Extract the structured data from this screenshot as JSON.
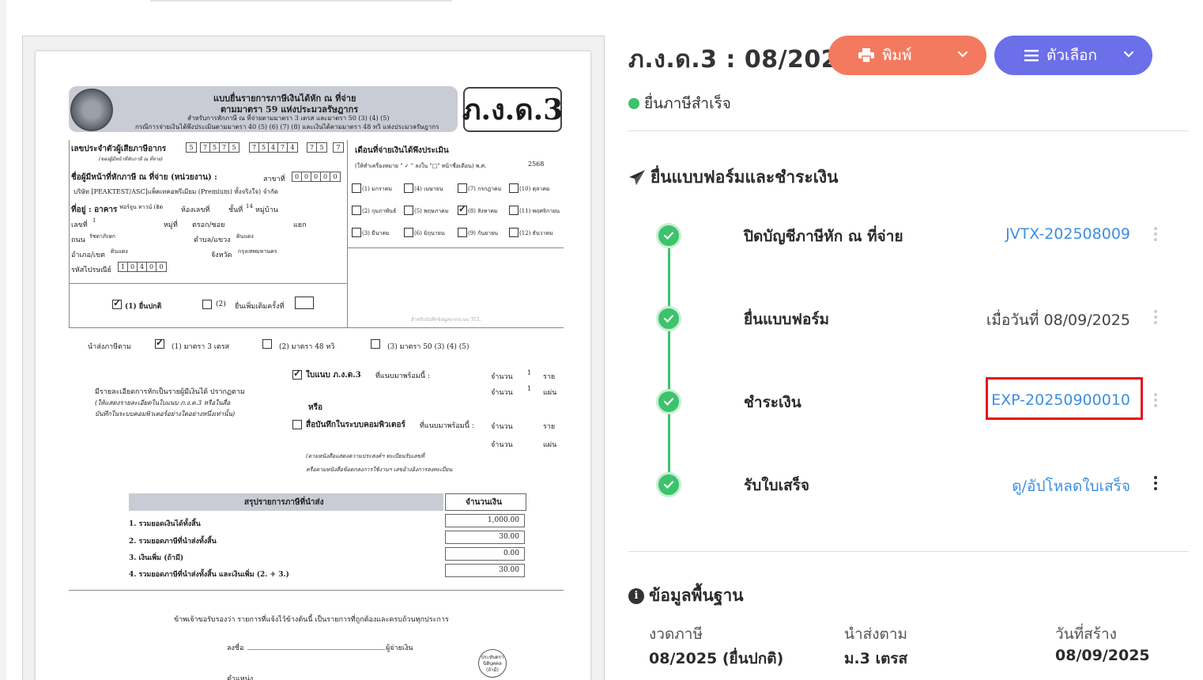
{
  "doc": {
    "form_badge": "ภ.ง.ด.3",
    "header_line1": "แบบยื่นรายการภาษีเงินได้หัก ณ ที่จ่าย",
    "header_line2": "ตามมาตรา 59 แห่งประมวลรัษฎากร",
    "header_line3": "สำหรับการหักภาษี ณ ที่จ่ายตามมาตรา 3 เตรส และมาตรา 50 (3) (4) (5)",
    "header_line4": "กรณีการจ่ายเงินได้พึงประเมินตามมาตรา 40 (5) (6) (7) (8) และเงินได้ตามมาตรา 48 ทวิ แห่งประมวลรัษฎากร",
    "taxid_label": "เลขประจำตัวผู้เสียภาษีอากร",
    "taxid_sub": "(ของผู้มีหน้าที่หักภาษี ณ ที่จ่าย)",
    "taxid_digits": [
      "5",
      "7",
      "5",
      "7",
      "5",
      "7",
      "5",
      "4",
      "7",
      "4",
      "7",
      "5",
      "7"
    ],
    "payer_label": "ชื่อผู้มีหน้าที่หักภาษี ณ ที่จ่าย (หน่วยงาน) :",
    "branch_label": "สาขาที่",
    "branch_digits": [
      "0",
      "0",
      "0",
      "0",
      "0"
    ],
    "payer_name": "บริษัท [PEAKTEST/ASC]แพ็คเทคอพรีเมียม (Premium) ทั้งจริงใจ) จำกัด",
    "addr_label": "ที่อยู่ : อาคาร",
    "addr_building": "ฟอร์จูน ทาวน์ (ฮิต",
    "addr_room": "ห้องเลขที่",
    "addr_floor": "ชั้นที่",
    "addr_floor_val": "14",
    "addr_village": "หมู่บ้าน",
    "addr_no": "เลขที่",
    "addr_no_val": "1",
    "addr_moo": "หมู่ที่",
    "addr_soi": "ตรอก/ซอย",
    "addr_yaek": "แยก",
    "addr_road": "ถนน",
    "addr_road_val": "รัชดาภิเษก",
    "addr_tambon": "ตำบล/แขวง",
    "addr_tambon_val": "ดินแดง",
    "addr_amphoe": "อำเภอ/เขต",
    "addr_amphoe_val": "ดินแดง",
    "addr_province": "จังหวัด",
    "addr_province_val": "กรุงเทพมหานคร",
    "postcode_label": "รหัสไปรษณีย์",
    "postcode_digits": [
      "1",
      "0",
      "4",
      "0",
      "0"
    ],
    "month_label": "เดือนที่จ่ายเงินได้พึงประเมิน",
    "month_hint": "(ให้ทำเครื่องหมาย \" ✓ \" ลงใน \"□\" หน้าชื่อเดือน) พ.ศ.",
    "year": "2568",
    "months": [
      "(1) มกราคม",
      "(4) เมษายน",
      "(7) กรกฎาคม",
      "(10) ตุลาคม",
      "(2) กุมภาพันธ์",
      "(5) พฤษภาคม",
      "(8) สิงหาคม",
      "(11) พฤศจิกายน",
      "(3) มีนาคม",
      "(6) มิถุนายน",
      "(9) กันยายน",
      "(12) ธันวาคม"
    ],
    "filing_normal": "(1) ยื่นปกติ",
    "filing_extra_num": "(2)",
    "filing_extra": "ยื่นเพิ่มเติมครั้งที่",
    "tcl_note": "สำหรับบันทึกข้อมูลจากระบบ TCL",
    "submit_label": "นำส่งภาษีตาม",
    "submit_opt1": "(1) มาตรา 3 เตรส",
    "submit_opt2": "(2) มาตรา 48 ทวิ",
    "submit_opt3": "(3) มาตรา 50 (3) (4) (5)",
    "attach_label": "ใบแนบ ภ.ง.ด.3",
    "attach_tail": "ที่แนบมาพร้อมนี้ :",
    "count_label": "จำนวน",
    "count_val1": "1",
    "count_unit1": "ราย",
    "count_val2": "1",
    "count_unit2": "แผ่น",
    "detail_l1": "มีรายละเอียดการหักเป็นรายผู้มีเงินได้ ปรากฏตาม",
    "detail_l2": "(ให้แสดงรายละเอียดในใบแนบ ภ.ง.ด.3 หรือในสื่อ",
    "detail_l3": "บันทึกในระบบคอมพิวเตอร์อย่างใดอย่างหนึ่งเท่านั้น)",
    "or_label": "หรือ",
    "media_label": "สื่อบันทึกในระบบคอมพิวเตอร์",
    "media_tail": "ที่แนบมาพร้อมนี้ :",
    "note_l1": "(ตามหนังสือแสดงความประสงค์ฯ ทะเบียนรับเลขที่",
    "note_l2": "หรือตามหนังสือข้อตกลงการใช้งานฯ เลขอ้างอิงการลงทะเบียน",
    "summary_title": "สรุปรายการภาษีที่นำส่ง",
    "amount_title": "จำนวนเงิน",
    "sum_rows": [
      {
        "label": "1. รวมยอดเงินได้ทั้งสิ้น",
        "value": "1,000.00"
      },
      {
        "label": "2. รวมยอดภาษีที่นำส่งทั้งสิ้น",
        "value": "30.00"
      },
      {
        "label": "3. เงินเพิ่ม (ถ้ามี)",
        "value": "0.00"
      },
      {
        "label": "4. รวมยอดภาษีที่นำส่งทั้งสิ้น และเงินเพิ่ม (2. + 3.)",
        "value": "30.00"
      }
    ],
    "certify": "ข้าพเจ้าขอรับรองว่า รายการที่แจ้งไว้ข้างต้นนี้ เป็นรายการที่ถูกต้องและครบถ้วนทุกประการ",
    "sign_label": "ลงชื่อ",
    "payer_sign": "ผู้จ่ายเงิน",
    "position_label": "ตำแหน่ง",
    "stamp_text": "ประทับตรานิติบุคคล (ถ้ามี)"
  },
  "header": {
    "title": "ภ.ง.ด.3 : 08/2025",
    "print_label": "พิมพ์",
    "options_label": "ตัวเลือก",
    "status": "ยื่นภาษีสำเร็จ",
    "print_color": "#f37a5f",
    "options_color": "#6b6fe8",
    "status_color": "#3cc36c"
  },
  "section": {
    "title": "ยื่นแบบฟอร์มและชำระเงิน",
    "steps": [
      {
        "label": "ปิดบัญชีภาษีหัก ณ ที่จ่าย",
        "value": "JVTX-202508009"
      },
      {
        "label": "ยื่นแบบฟอร์ม",
        "value": "เมื่อวันที่ 08/09/2025"
      },
      {
        "label": "ชำระเงิน",
        "value": "EXP-20250900010"
      },
      {
        "label": "รับใบเสร็จ",
        "value": "ดู/อัปโหลดใบเสร็จ"
      }
    ]
  },
  "info": {
    "title": "ข้อมูลพื้นฐาน",
    "period_label": "งวดภาษี",
    "period_value": "08/2025 (ยื่นปกติ)",
    "submit_label": "นำส่งตาม",
    "submit_value": "ม.3 เตรส",
    "created_label": "วันที่สร้าง",
    "created_value": "08/09/2025"
  }
}
